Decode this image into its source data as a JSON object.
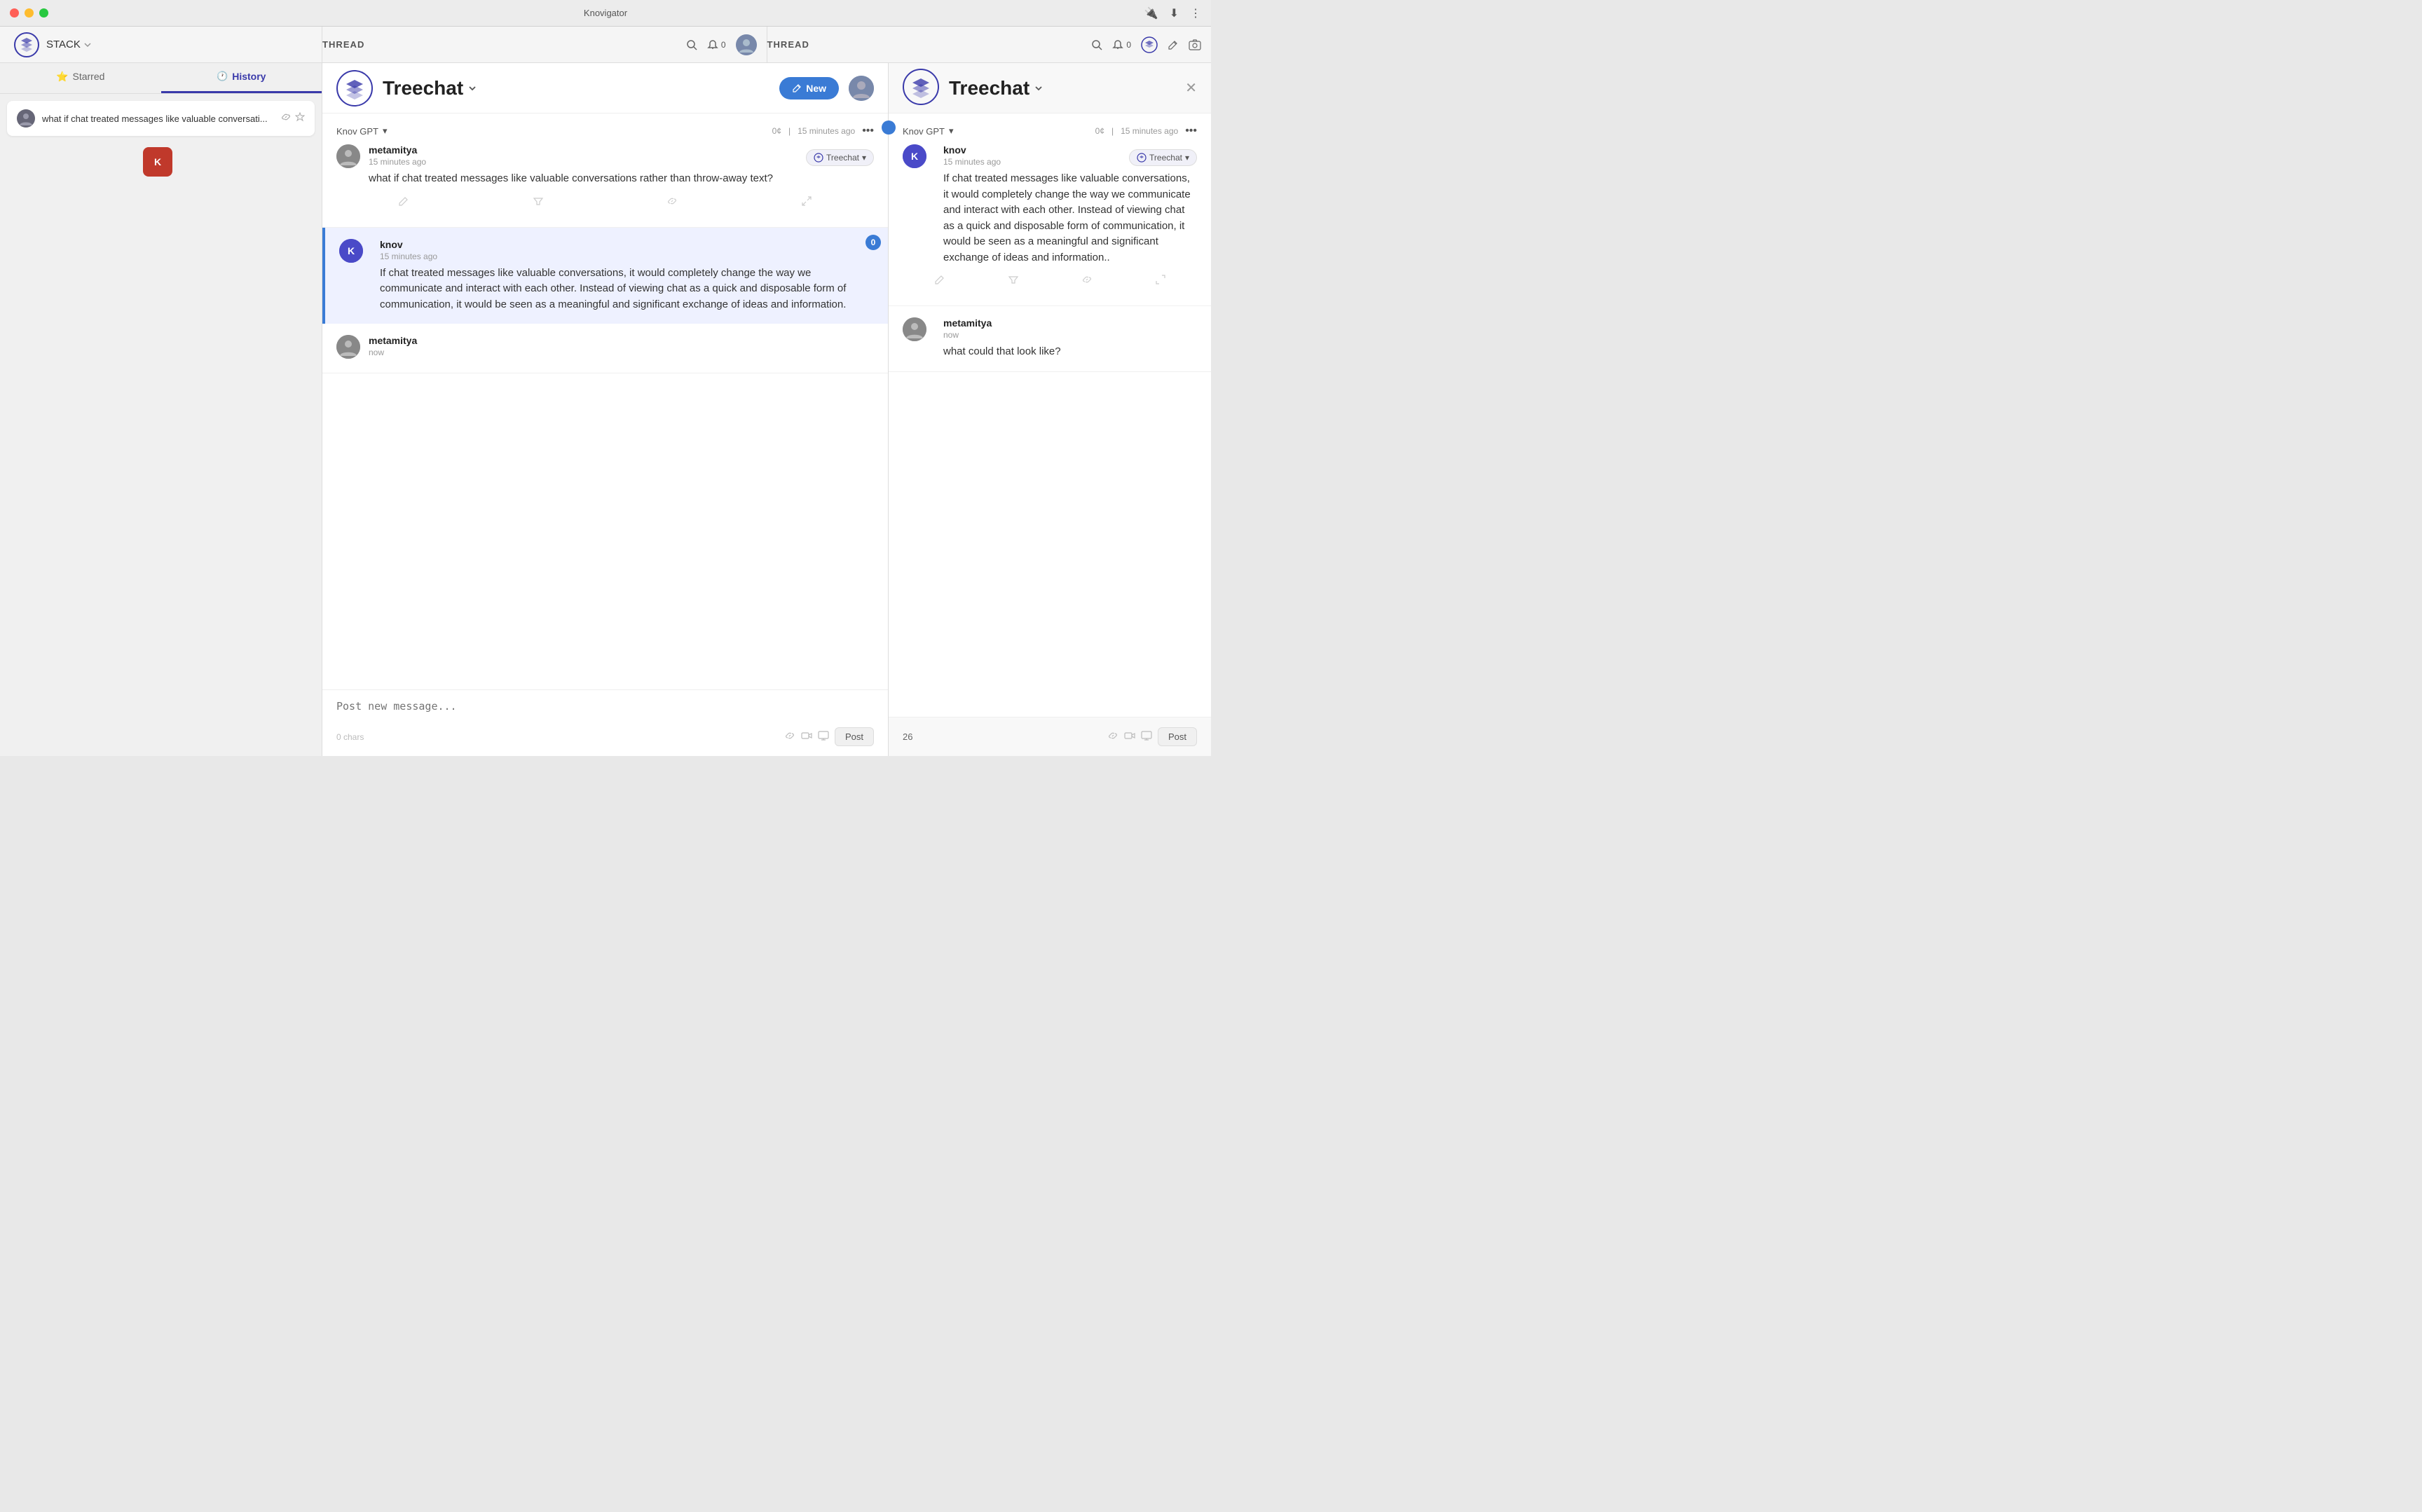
{
  "titlebar": {
    "title": "Knovigator",
    "plugin_icon": "🔌",
    "download_icon": "⬇",
    "more_icon": "⋮"
  },
  "nav": {
    "stack_label": "STACK",
    "thread_label": "THREAD",
    "thread_label_right": "THREAD",
    "bell_count": "0",
    "bell_count_right": "0"
  },
  "sidebar": {
    "starred_tab": "Starred",
    "history_tab": "History",
    "history_icon": "🕐",
    "item_text": "what if chat treated messages like valuable conversati...",
    "item_link_icon": "🔗",
    "item_star_icon": "☆"
  },
  "thread_left": {
    "title": "Treechat",
    "new_btn": "New",
    "provider": "Knov GPT",
    "provider_chevron": "▾",
    "cost": "0¢",
    "time": "15 minutes ago",
    "more_icon": "•••",
    "tag_label": "Treechat",
    "tag_chevron": "▾",
    "message1": {
      "author": "metamitya",
      "time": "15 minutes ago",
      "text": "what if chat treated messages like valuable conversations rather than throw-away text?"
    },
    "message2": {
      "author": "knov",
      "time": "15 minutes ago",
      "badge": "0",
      "text": "If chat treated messages like valuable conversations, it would completely change the way we communicate and interact with each other. Instead of viewing chat as a quick and disposable form of communication, it would be seen as a meaningful and significant exchange of ideas and information."
    },
    "message3_author": "metamitya",
    "message3_time": "now",
    "input_placeholder": "Post new message...",
    "char_count": "0 chars",
    "post_btn": "Post"
  },
  "thread_right": {
    "title": "Treechat",
    "provider": "Knov GPT",
    "provider_chevron": "▾",
    "cost": "0¢",
    "time": "15 minutes ago",
    "more_icon": "•••",
    "tag_label": "Treechat",
    "tag_chevron": "▾",
    "message1": {
      "author": "knov",
      "time": "15 minutes ago",
      "text": "If chat treated messages like valuable conversations, it would completely change the way we communicate and interact with each other. Instead of viewing chat as a quick and disposable form of communication, it would be seen as a meaningful and significant exchange of ideas and information.."
    },
    "message2": {
      "author": "metamitya",
      "time": "now",
      "text": "what could that look like?"
    },
    "char_count": "26",
    "post_btn": "Post"
  }
}
